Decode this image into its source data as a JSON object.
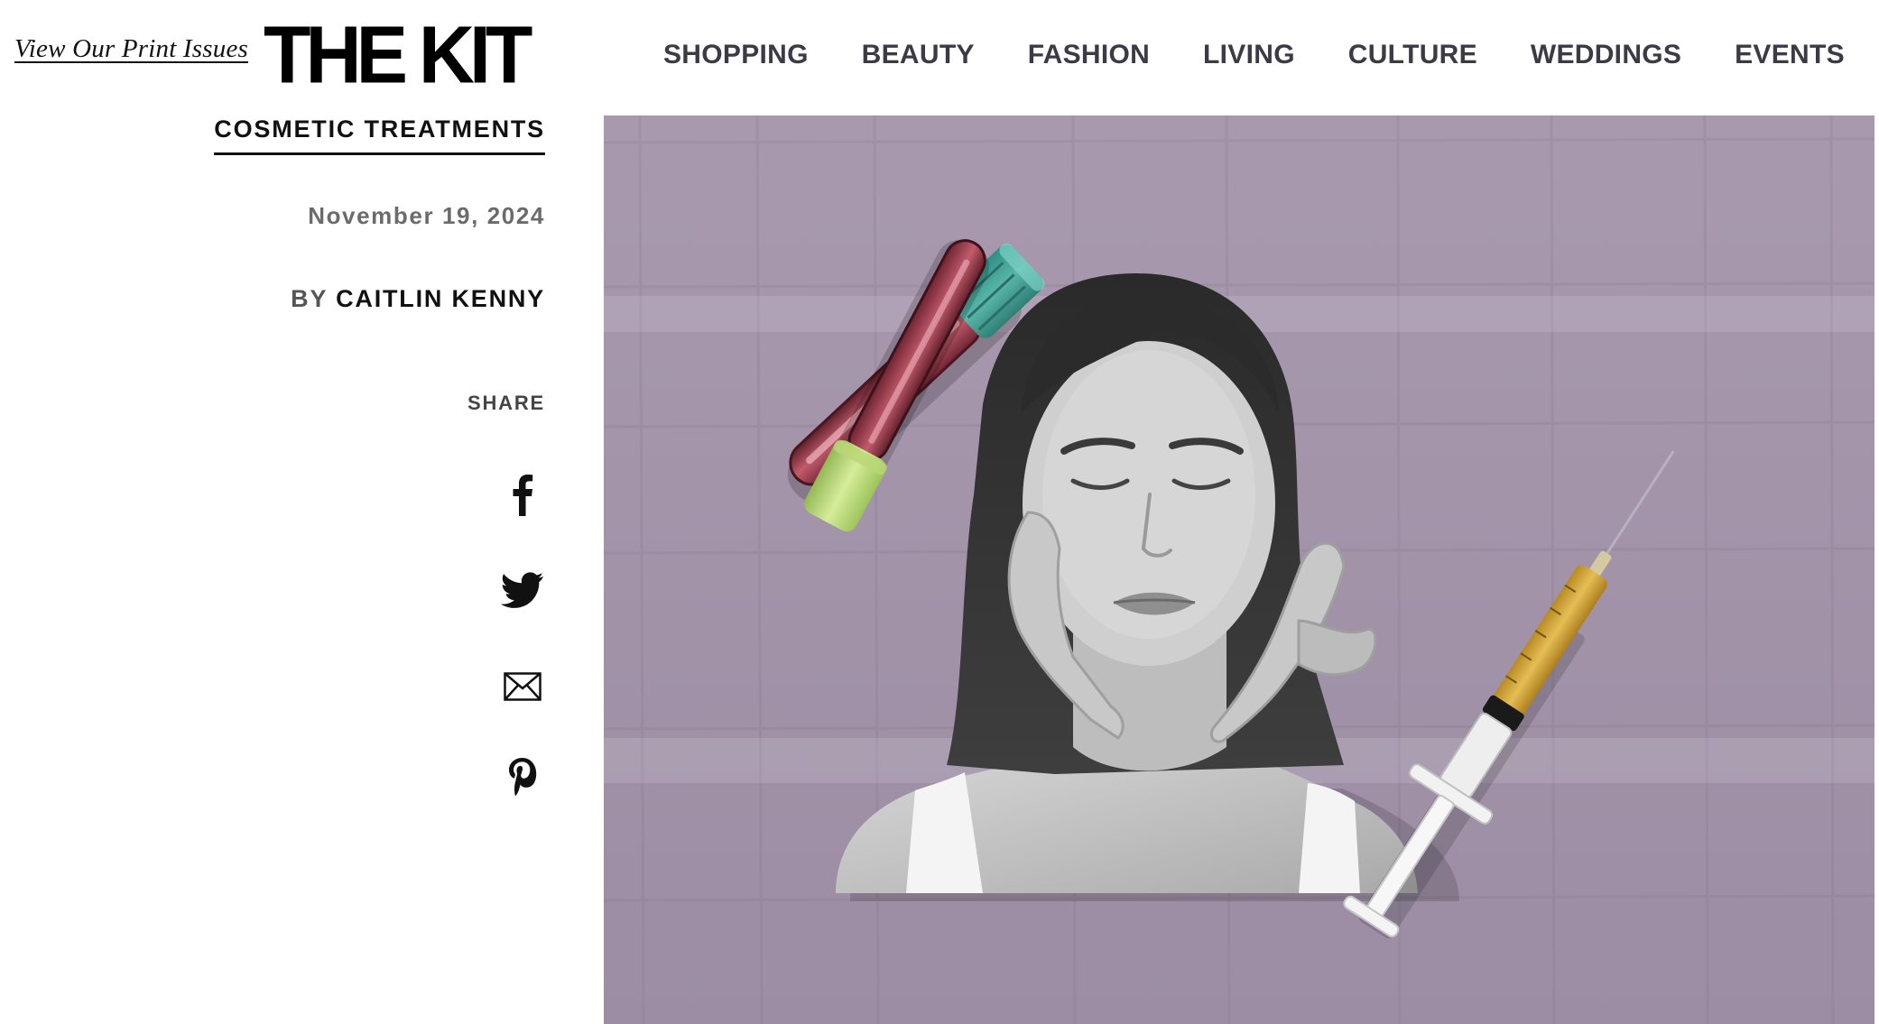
{
  "header": {
    "print_link": "View Our Print Issues",
    "logo": "THE KIT",
    "nav": [
      "SHOPPING",
      "BEAUTY",
      "FASHION",
      "LIVING",
      "CULTURE",
      "WEDDINGS",
      "EVENTS"
    ]
  },
  "article": {
    "category": "COSMETIC TREATMENTS",
    "date": "November 19, 2024",
    "byline_prefix": "BY",
    "author": "CAITLIN KENNY",
    "share_label": "SHARE",
    "share_icons": [
      "facebook-icon",
      "twitter-icon",
      "email-icon",
      "pinterest-icon"
    ]
  },
  "hero": {
    "background_color": "#a494ab",
    "subjects": [
      "woman-face-photo",
      "blood-vial-teal-cap",
      "blood-vial-green-cap",
      "syringe"
    ]
  }
}
